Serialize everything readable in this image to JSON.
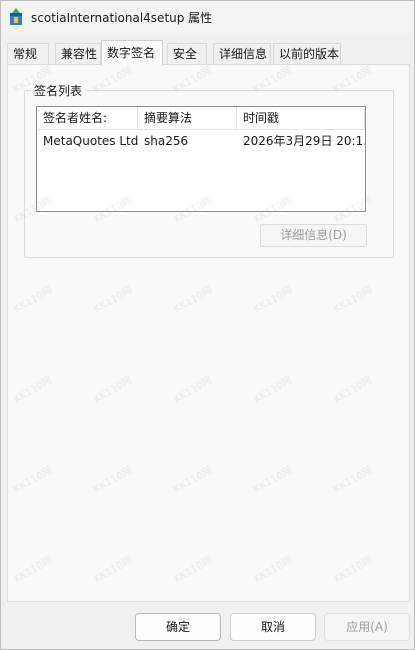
{
  "window": {
    "title": "scotiaInternational4setup 属性"
  },
  "tabs": [
    {
      "label": "常规",
      "active": false
    },
    {
      "label": "兼容性",
      "active": false
    },
    {
      "label": "数字签名",
      "active": true
    },
    {
      "label": "安全",
      "active": false
    },
    {
      "label": "详细信息",
      "active": false
    },
    {
      "label": "以前的版本",
      "active": false
    }
  ],
  "signature_list": {
    "group_label": "签名列表",
    "columns": [
      "签名者姓名:",
      "摘要算法",
      "时间戳"
    ],
    "rows": [
      {
        "signer": "MetaQuotes Ltd.",
        "algorithm": "sha256",
        "timestamp": "2026年3月29日 20:1..."
      }
    ],
    "details_button": "详细信息(D)"
  },
  "buttons": {
    "ok": "确定",
    "cancel": "取消",
    "apply": "应用(A)"
  },
  "watermark_text": "KK110网"
}
